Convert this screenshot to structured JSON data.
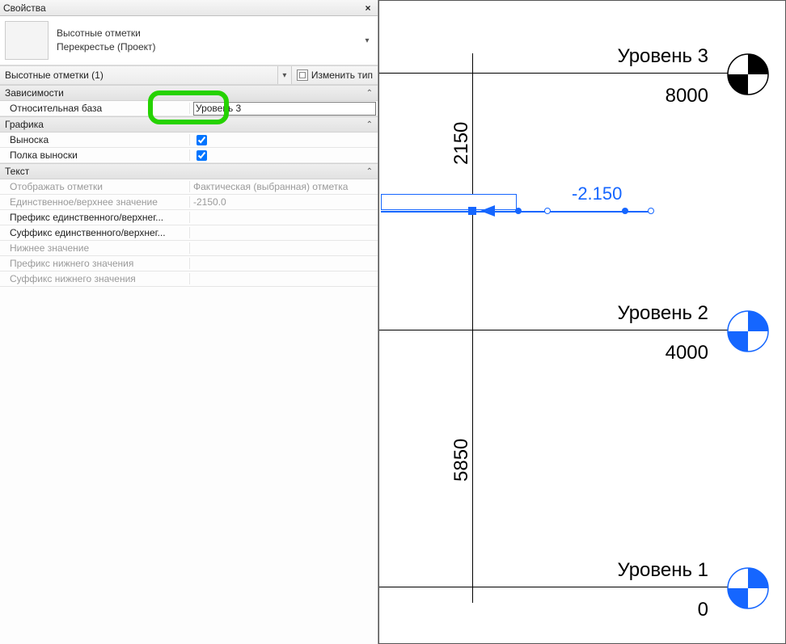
{
  "panel": {
    "title": "Свойства",
    "type_line1": "Высотные отметки",
    "type_line2": "Перекрестье (Проект)",
    "filter_text": "Высотные отметки (1)",
    "edit_type_label": "Изменить тип"
  },
  "groups": {
    "constraints": {
      "header": "Зависимости",
      "rel_base_label": "Относительная база",
      "rel_base_value": "Уровень 3"
    },
    "graphics": {
      "header": "Графика",
      "leader_label": "Выноска",
      "leader_checked": true,
      "shoulder_label": "Полка выноски",
      "shoulder_checked": true
    },
    "text": {
      "header": "Текст",
      "display_label": "Отображать отметки",
      "display_value": "Фактическая (выбранная) отметка",
      "single_upper_label": "Единственное/верхнее значение",
      "single_upper_value": "-2150.0",
      "prefix_upper_label": "Префикс единственного/верхнег...",
      "suffix_upper_label": "Суффикс единственного/верхнег...",
      "lower_label": "Нижнее значение",
      "prefix_lower_label": "Префикс нижнего значения",
      "suffix_lower_label": "Суффикс нижнего значения"
    }
  },
  "levels": {
    "l3": {
      "name": "Уровень 3",
      "value": "8000"
    },
    "l2": {
      "name": "Уровень 2",
      "value": "4000"
    },
    "l1": {
      "name": "Уровень 1",
      "value": "0"
    }
  },
  "dims": {
    "d1": "2150",
    "d2": "5850"
  },
  "spot": {
    "value": "-2.150"
  },
  "colors": {
    "blue": "#1566ff",
    "highlight": "#25d200"
  }
}
